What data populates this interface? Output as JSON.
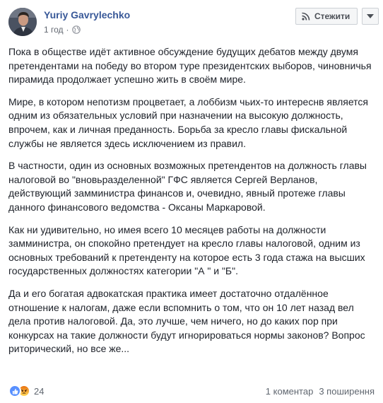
{
  "post": {
    "author": "Yuriy Gavrylechko",
    "time": "1 год",
    "separator": "·",
    "privacy_icon": "globe-icon"
  },
  "actions": {
    "follow_label": "Стежити",
    "follow_icon": "rss-icon",
    "more_icon": "chevron-down-icon"
  },
  "body": {
    "paragraphs": [
      "Пока в обществе идёт активное обсуждение будущих дебатов между двумя претендентами на победу во втором туре президентских выборов, чиновничья пирамида продолжает успешно жить в своём мире.",
      "Мире, в котором непотизм процветает, а лоббизм чьих-то интереснв является одним из обязательных условий при назначении на высокую должность, впрочем, как и личная преданность. Борьба за кресло главы фискальной службы не является здесь исключением из правил.",
      "В частности, один из основных возможных претендентов на должность главы налоговой во \"вновьразделенной\" ГФС является Сергей Верланов, действующий замминистра финансов и, очевидно, явный протеже главы данного финансового ведомства - Оксаны Маркаровой.",
      "Как ни удивительно, но имея всего 10 месяцев работы на должности замминистра, он спокойно претендует на кресло главы налоговой, одним из основных требований к претенденту на которое есть 3 года стажа на высших государственных должностях категории \"А \" и \"Б\".",
      "Да и его богатая адвокатская практика имеет достаточно отдалённое отношение к налогам, даже если вспомнить о том, что он 10 лет назад вел дела против налоговой. Да, это лучше, чем ничего, но до каких пор при конкурсах на такие должности будут игнорироваться нормы законов? Вопрос риторический, но все же..."
    ]
  },
  "footer": {
    "reaction_icons": [
      "like-icon",
      "angry-icon"
    ],
    "reaction_count": "24",
    "comments": "1 коментар",
    "shares": "3 поширення"
  },
  "colors": {
    "author": "#385898",
    "like": "#5890ff",
    "angry": "#e9710f",
    "text": "#1d2129",
    "muted": "#616770"
  }
}
